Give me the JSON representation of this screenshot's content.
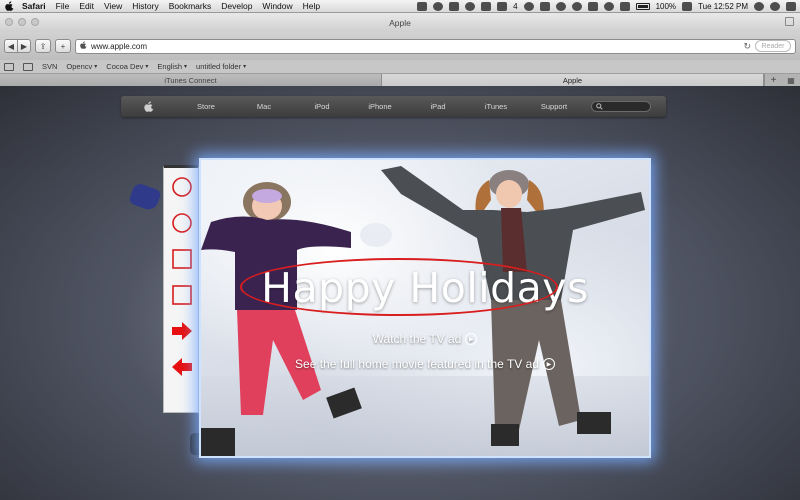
{
  "menubar": {
    "app_name": "Safari",
    "items": [
      "File",
      "Edit",
      "View",
      "History",
      "Bookmarks",
      "Develop",
      "Window",
      "Help"
    ],
    "status_badge": "4",
    "battery": "100%",
    "clock": "Tue 12:52 PM"
  },
  "window": {
    "title": "Apple",
    "url": "www.apple.com",
    "reader_label": "Reader"
  },
  "bookmarks": {
    "items": [
      {
        "label": "SVN",
        "menu": false
      },
      {
        "label": "Opencv",
        "menu": true
      },
      {
        "label": "Cocoa Dev",
        "menu": true
      },
      {
        "label": "English",
        "menu": true
      },
      {
        "label": "untitled folder",
        "menu": true
      }
    ]
  },
  "tabs": [
    {
      "label": "iTunes Connect",
      "active": false
    },
    {
      "label": "Apple",
      "active": true
    }
  ],
  "apple_nav": {
    "items": [
      "Store",
      "Mac",
      "iPod",
      "iPhone",
      "iPad",
      "iTunes",
      "Support"
    ]
  },
  "hero": {
    "title": "Happy Holidays",
    "link1": "Watch the TV ad",
    "link2": "See the full home movie featured in the TV ad"
  },
  "palette": {
    "tools": [
      "ellipse-tool",
      "circle-tool",
      "square-tool",
      "rectangle-tool",
      "arrow-right-tool",
      "arrow-left-tool"
    ]
  },
  "colors": {
    "annotation_red": "#d81e1e",
    "hero_glow": "#78aaff"
  }
}
